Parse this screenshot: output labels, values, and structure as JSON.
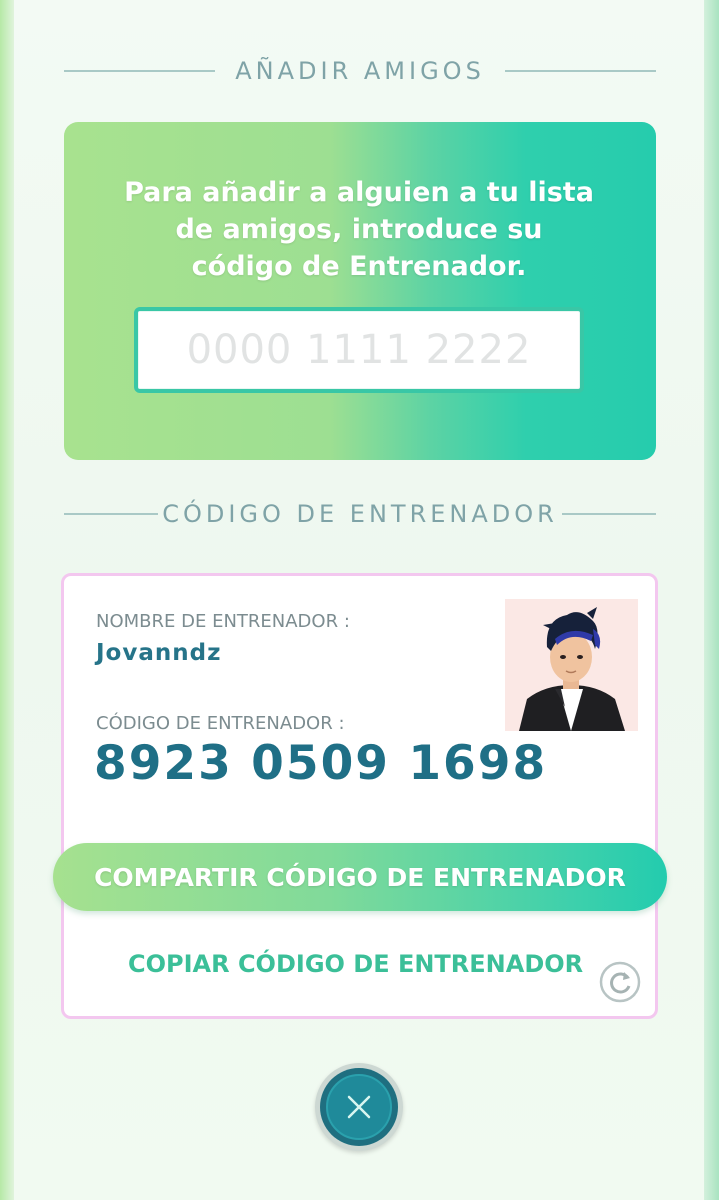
{
  "add_friends": {
    "title": "AÑADIR AMIGOS",
    "instructions": "Para añadir a alguien a tu lista de amigos, introduce su código de Entrenador.",
    "input_placeholder": "0000 1111 2222"
  },
  "trainer_code_section": {
    "title": "CÓDIGO DE ENTRENADOR"
  },
  "trainer_card": {
    "name_label": "NOMBRE DE ENTRENADOR :",
    "name": "Jovanndz",
    "code_label": "CÓDIGO DE ENTRENADOR :",
    "code": "8923 0509 1698"
  },
  "actions": {
    "share_label": "COMPARTIR CÓDIGO DE ENTRENADOR",
    "copy_label": "COPIAR CÓDIGO DE ENTRENADOR"
  },
  "icons": {
    "refresh": "refresh-icon",
    "close": "close-icon"
  },
  "colors": {
    "accent_teal": "#26ccad",
    "accent_green": "#a6e18f",
    "code_text": "#1f6f86",
    "card_border": "#f3c7ef"
  }
}
